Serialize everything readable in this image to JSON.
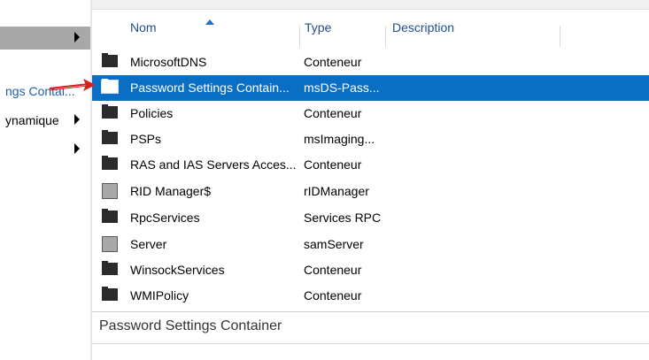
{
  "tree": {
    "items": [
      {
        "label": "",
        "has_children": true,
        "selected": true
      },
      {
        "label": "ngs Contai...",
        "has_children": false,
        "selected": false
      },
      {
        "label": "ynamique",
        "has_children": true,
        "selected": false
      },
      {
        "label": "",
        "has_children": true,
        "selected": false
      }
    ]
  },
  "list": {
    "columns": [
      {
        "label": "Nom",
        "sorted": "ascending"
      },
      {
        "label": "Type"
      },
      {
        "label": "Description"
      }
    ],
    "rows": [
      {
        "name": "MicrosoftDNS",
        "type": "Conteneur",
        "icon": "folder-icon",
        "selected": false
      },
      {
        "name": "Password Settings Contain...",
        "type": "msDS-Pass...",
        "icon": "folder-icon",
        "selected": true
      },
      {
        "name": "Policies",
        "type": "Conteneur",
        "icon": "folder-icon",
        "selected": false
      },
      {
        "name": "PSPs",
        "type": "msImaging...",
        "icon": "folder-icon",
        "selected": false
      },
      {
        "name": "RAS and IAS Servers Acces...",
        "type": "Conteneur",
        "icon": "folder-icon",
        "selected": false
      },
      {
        "name": "RID Manager$",
        "type": "rIDManager",
        "icon": "object-icon",
        "selected": false
      },
      {
        "name": "RpcServices",
        "type": "Services RPC",
        "icon": "folder-icon",
        "selected": false
      },
      {
        "name": "Server",
        "type": "samServer",
        "icon": "object-icon",
        "selected": false
      },
      {
        "name": "WinsockServices",
        "type": "Conteneur",
        "icon": "folder-icon",
        "selected": false
      },
      {
        "name": "WMIPolicy",
        "type": "Conteneur",
        "icon": "folder-icon",
        "selected": false
      }
    ]
  },
  "details": {
    "title": "Password Settings Container"
  },
  "colors": {
    "selection": "#0a6ec4",
    "header_text": "#1f4e8c",
    "tree_selected": "#a8a8a8",
    "annotation_arrow": "#d62020"
  }
}
